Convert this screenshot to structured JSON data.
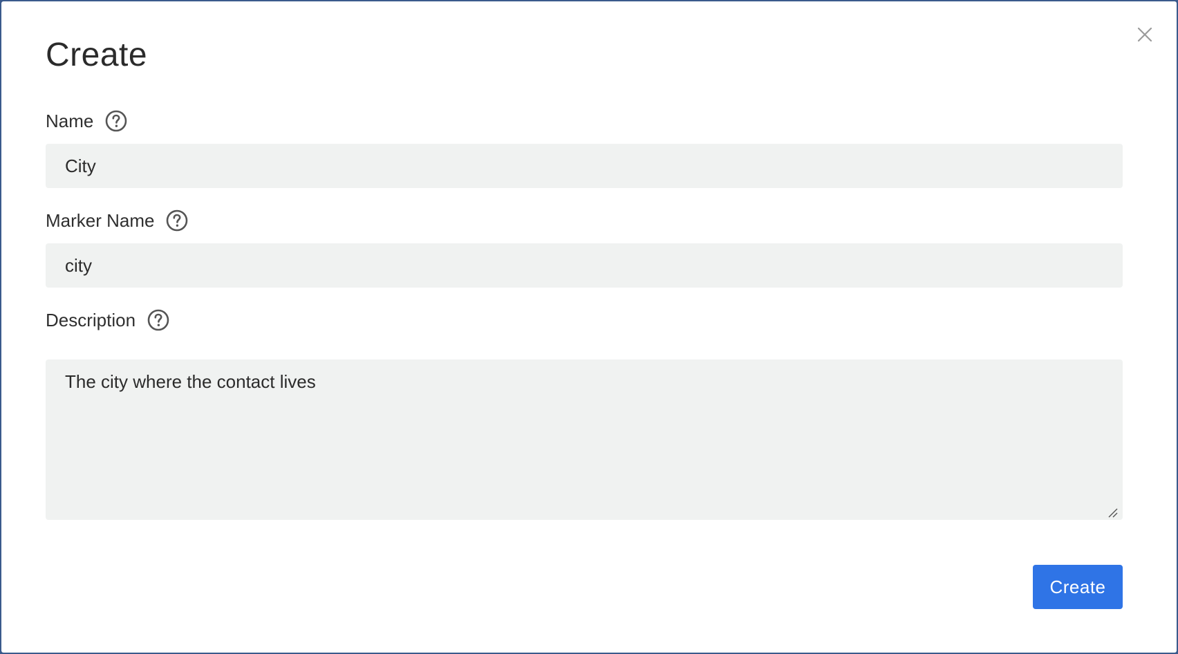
{
  "dialog": {
    "title": "Create",
    "close_icon": "close-icon"
  },
  "fields": {
    "name": {
      "label": "Name",
      "value": "City",
      "help_icon": "question-circle-icon"
    },
    "marker_name": {
      "label": "Marker Name",
      "value": "city",
      "help_icon": "question-circle-icon"
    },
    "description": {
      "label": "Description",
      "value": "The city where the contact lives",
      "help_icon": "question-circle-icon"
    }
  },
  "actions": {
    "create_label": "Create"
  },
  "colors": {
    "primary_button": "#2f74e6",
    "input_background": "#f0f2f1"
  }
}
